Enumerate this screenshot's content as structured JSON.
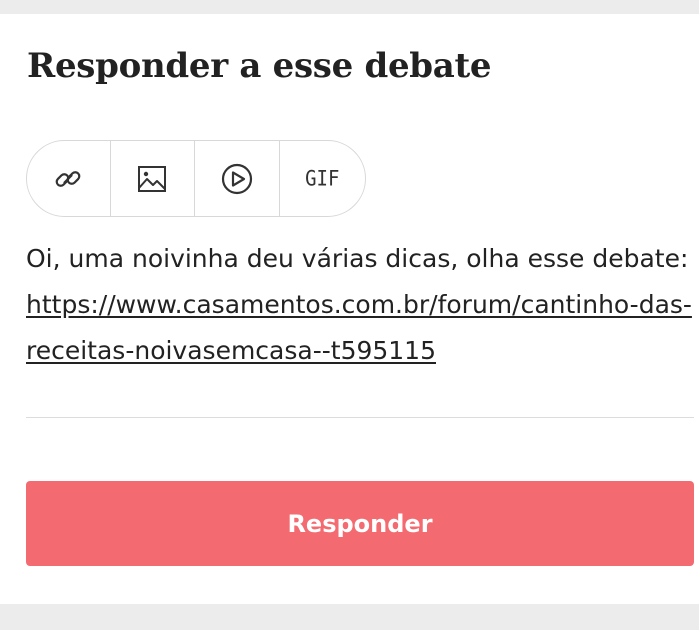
{
  "form": {
    "title": "Responder a esse debate",
    "toolbar": {
      "items": [
        {
          "icon": "link-icon",
          "label": ""
        },
        {
          "icon": "image-icon",
          "label": ""
        },
        {
          "icon": "play-video-icon",
          "label": ""
        },
        {
          "icon": "gif-icon",
          "label": "GIF"
        }
      ]
    },
    "message": {
      "text": "Oi, uma noivinha deu várias dicas, olha esse debate:",
      "link": "https://www.casamentos.com.br/forum/cantinho-das-receitas-noivasemcasa--t595115"
    },
    "submit_label": "Responder"
  },
  "colors": {
    "accent": "#f36b70",
    "background": "#ececec",
    "card": "#ffffff",
    "border": "#d8d8d8"
  }
}
